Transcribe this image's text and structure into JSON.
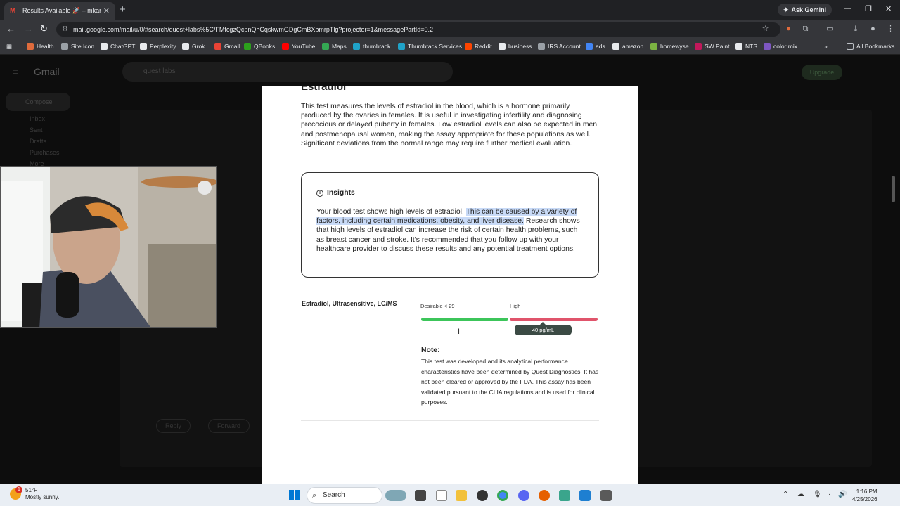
{
  "browser": {
    "tab_title": "Results Available 🚀 – mkartsu...",
    "tab_favicon": "M",
    "new_tab": "+",
    "ask_gemini": "Ask Gemini",
    "url": "mail.google.com/mail/u/0/#search/quest+labs%5C/FMfcgzQcpnQhCqskwmGDgCmBXbmrpTlg?projector=1&messagePartId=0.2",
    "bookmarks": [
      "Health",
      "Site Icon",
      "ChatGPT",
      "Perplexity",
      "Grok",
      "Gmail",
      "QBooks",
      "YouTube",
      "Maps",
      "thumbtack",
      "Thumbtack Services",
      "Reddit",
      "business",
      "IRS Account",
      "ads",
      "amazon",
      "homewyse",
      "SW Paint",
      "NTS",
      "color mix"
    ],
    "all_bookmarks": "All Bookmarks",
    "bookmark_colors": [
      "#e06b3c",
      "#9aa0a6",
      "#e8eaed",
      "#e8eaed",
      "#e8eaed",
      "#ea4335",
      "#2ca01c",
      "#ff0000",
      "#34a853",
      "#1fa2c8",
      "#1fa2c8",
      "#ff4500",
      "#e8eaed",
      "#9aa0a6",
      "#4285f4",
      "#e8eaed",
      "#7cb342",
      "#c2185b",
      "#e8eaed",
      "#7e57c2"
    ]
  },
  "gmail": {
    "logo": "Gmail",
    "search_value": "quest labs",
    "upgrade": "Upgrade",
    "compose": "Compose",
    "nav": [
      "Inbox",
      "Sent",
      "Drafts",
      "Purchases",
      "More"
    ],
    "reply": "Reply",
    "forward": "Forward"
  },
  "report": {
    "title": "Estradiol",
    "description": "This test measures the levels of estradiol in the blood, which is a hormone primarily produced by the ovaries in females. It is useful in investigating infertility and diagnosing precocious or delayed puberty in females. Low estradiol levels can also be expected in men and postmenopausal women, making the assay appropriate for these populations as well. Significant deviations from the normal range may require further medical evaluation.",
    "insights_heading": "Insights",
    "insights_text_1": "Your blood test shows high levels of estradiol. ",
    "insights_text_highlighted": "This can be caused by a variety of factors, including certain medications, obesity, and liver disease.",
    "insights_text_2": " Research shows that high levels of estradiol can increase the risk of certain health problems, such as breast cancer and stroke. It's recommended that you follow up with your healthcare provider to discuss these results and any potential treatment options.",
    "test_name": "Estradiol, Ultrasensitive, LC/MS",
    "range_desirable": "Desirable < 29",
    "range_high": "High",
    "result_value": "40 pg/mL",
    "note_label": "Note:",
    "note_text": "This test was developed and its analytical performance characteristics have been determined by Quest Diagnostics. It has not been cleared or approved by the FDA. This assay has been validated pursuant to the CLIA regulations and is used for clinical purposes."
  },
  "taskbar": {
    "temperature": "51°F",
    "condition": "Mostly sunny.",
    "weather_badge": "1",
    "search_label": "Search",
    "time": "1:16 PM",
    "date": "4/25/2026"
  },
  "colors": {
    "range_green": "#3cc55a",
    "range_red": "#e0546b",
    "highlight": "#c8daf7"
  }
}
